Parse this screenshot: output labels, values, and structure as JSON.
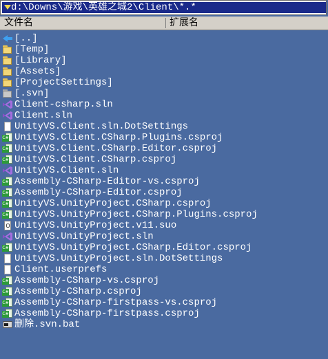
{
  "path": {
    "text": "d:\\Downs\\游戏\\英雄之城2\\Client\\*.*"
  },
  "columns": {
    "name": "文件名",
    "ext": "扩展名"
  },
  "files": [
    {
      "name": "[..]",
      "icon": "up-arrow-icon"
    },
    {
      "name": "[Temp]",
      "icon": "folder-icon"
    },
    {
      "name": "[Library]",
      "icon": "folder-icon"
    },
    {
      "name": "[Assets]",
      "icon": "folder-icon"
    },
    {
      "name": "[ProjectSettings]",
      "icon": "folder-icon"
    },
    {
      "name": "[.svn]",
      "icon": "folder-hidden-icon"
    },
    {
      "name": "Client-csharp.sln",
      "icon": "visual-studio-icon"
    },
    {
      "name": "Client.sln",
      "icon": "visual-studio-icon"
    },
    {
      "name": "UnityVS.Client.sln.DotSettings",
      "icon": "document-icon"
    },
    {
      "name": "UnityVS.Client.CSharp.Plugins.csproj",
      "icon": "csproj-icon"
    },
    {
      "name": "UnityVS.Client.CSharp.Editor.csproj",
      "icon": "csproj-icon"
    },
    {
      "name": "UnityVS.Client.CSharp.csproj",
      "icon": "csproj-icon"
    },
    {
      "name": "UnityVS.Client.sln",
      "icon": "visual-studio-icon"
    },
    {
      "name": "Assembly-CSharp-Editor-vs.csproj",
      "icon": "csproj-icon"
    },
    {
      "name": "Assembly-CSharp-Editor.csproj",
      "icon": "csproj-icon"
    },
    {
      "name": "UnityVS.UnityProject.CSharp.csproj",
      "icon": "csproj-icon"
    },
    {
      "name": "UnityVS.UnityProject.CSharp.Plugins.csproj",
      "icon": "csproj-icon"
    },
    {
      "name": "UnityVS.UnityProject.v11.suo",
      "icon": "suo-file-icon"
    },
    {
      "name": "UnityVS.UnityProject.sln",
      "icon": "visual-studio-icon"
    },
    {
      "name": "UnityVS.UnityProject.CSharp.Editor.csproj",
      "icon": "csproj-icon"
    },
    {
      "name": "UnityVS.UnityProject.sln.DotSettings",
      "icon": "document-icon"
    },
    {
      "name": "Client.userprefs",
      "icon": "document-icon"
    },
    {
      "name": "Assembly-CSharp-vs.csproj",
      "icon": "csproj-icon"
    },
    {
      "name": "Assembly-CSharp.csproj",
      "icon": "csproj-icon"
    },
    {
      "name": "Assembly-CSharp-firstpass-vs.csproj",
      "icon": "csproj-icon"
    },
    {
      "name": "Assembly-CSharp-firstpass.csproj",
      "icon": "csproj-icon"
    },
    {
      "name": "删除.svn.bat",
      "icon": "batch-file-icon"
    }
  ],
  "colors": {
    "panel_background": "#4a6aa0",
    "path_background": "#1a2a8a",
    "text": "#ffffff"
  }
}
